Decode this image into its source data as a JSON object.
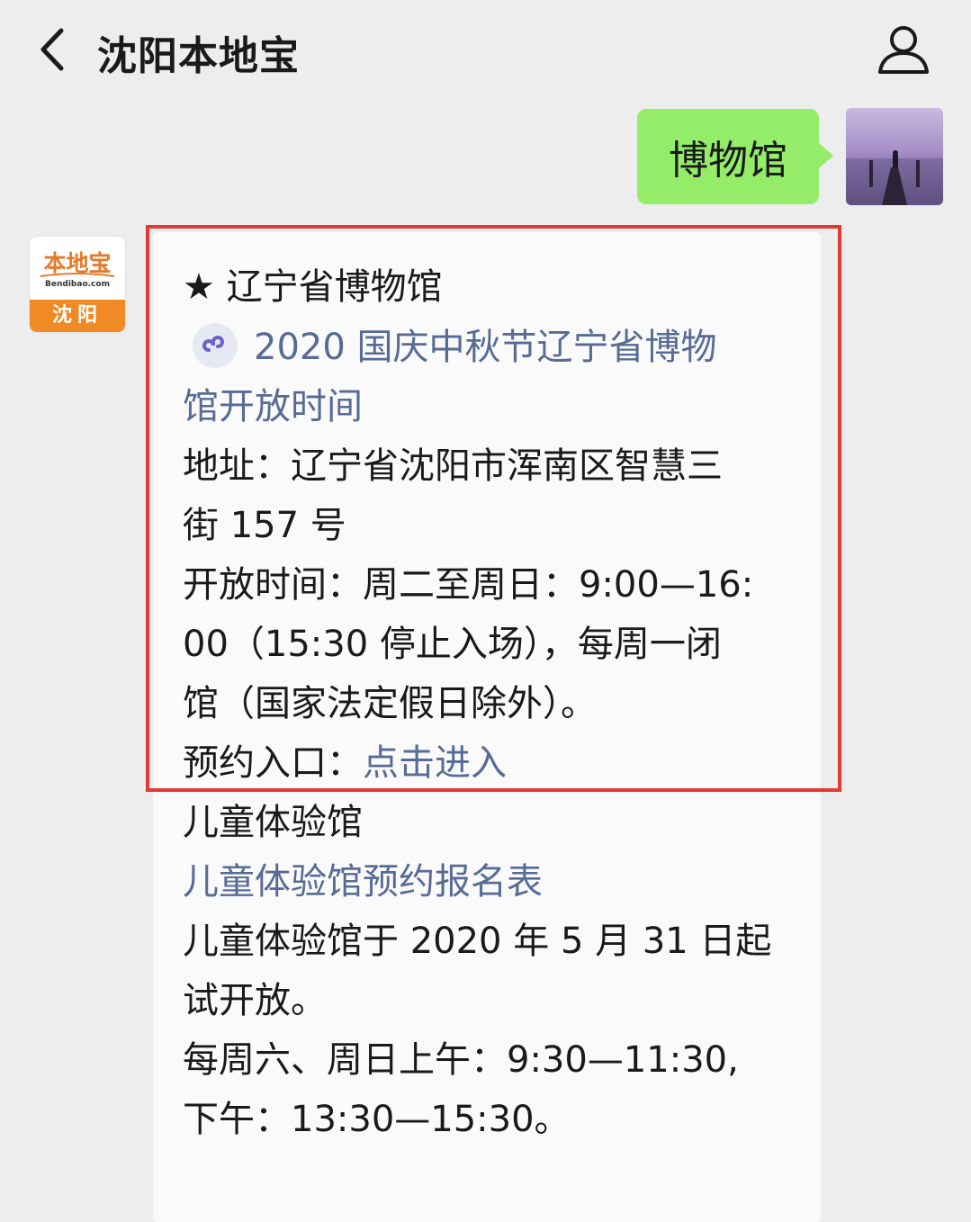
{
  "header": {
    "title": "沈阳本地宝",
    "back_icon": "chevron-left-icon",
    "profile_icon": "person-icon"
  },
  "chat": {
    "outgoing": {
      "text": "博物馆"
    },
    "account_avatar": {
      "brand": "本地宝",
      "domain": "Bendibao.com",
      "city": "沈阳",
      "color": "#f08a24"
    },
    "article": {
      "museum_title": "★ 辽宁省博物馆",
      "museum_link_line1": "2020 国庆中秋节辽宁省博物",
      "museum_link_line2": "馆开放时间",
      "address_line1": "地址：辽宁省沈阳市浑南区智慧三",
      "address_line2": "街 157 号",
      "hours_line1": "开放时间：周二至周日：9:00—16:",
      "hours_line2": "00（15:30 停止入场），每周一闭",
      "hours_line3": "馆（国家法定假日除外）。",
      "booking_label": "预约入口：",
      "booking_link": "点击进入",
      "children_title": "儿童体验馆",
      "children_link": "儿童体验馆预约报名表",
      "children_open_line1": "儿童体验馆于 2020 年 5 月 31 日起",
      "children_open_line2": "试开放。",
      "children_hours_line1": "每周六、周日上午：9:30—11:30,",
      "children_hours_line2": "下午：13:30—15:30。"
    }
  },
  "colors": {
    "background": "#ededed",
    "outgoing_bubble": "#95ec69",
    "link": "#576b95",
    "highlight": "#e53935"
  }
}
